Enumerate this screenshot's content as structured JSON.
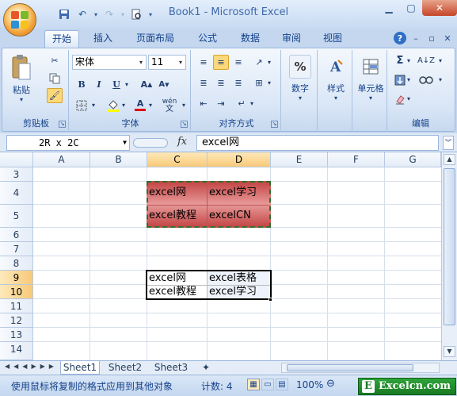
{
  "window": {
    "title": "Book1 - Microsoft Excel"
  },
  "ribbon_tabs": [
    "开始",
    "插入",
    "页面布局",
    "公式",
    "数据",
    "审阅",
    "视图"
  ],
  "clipboard": {
    "paste": "粘贴",
    "label": "剪贴板"
  },
  "font": {
    "name": "宋体",
    "size": "11",
    "label": "字体",
    "bold": "B",
    "italic": "I",
    "underline": "U"
  },
  "alignment": {
    "label": "对齐方式"
  },
  "number": {
    "label": "数字",
    "percent": "%"
  },
  "styles": {
    "label": "样式"
  },
  "cells": {
    "label": "单元格"
  },
  "editing": {
    "label": "编辑"
  },
  "formula_bar": {
    "name_box": "2R x 2C",
    "fx": "fx",
    "value": "excel网"
  },
  "columns": [
    "A",
    "B",
    "C",
    "D",
    "E",
    "F",
    "G"
  ],
  "rows": [
    "3",
    "4",
    "5",
    "6",
    "7",
    "8",
    "9",
    "10",
    "11",
    "12",
    "13",
    "14"
  ],
  "cells_data": {
    "c4": "excel网",
    "d4": "excel学习",
    "c5": "excel教程",
    "d5": "excelCN",
    "c9": "excel网",
    "d9": "excel表格",
    "c10": "excel教程",
    "d10": "excel学习"
  },
  "sheet_tabs": [
    "Sheet1",
    "Sheet2",
    "Sheet3"
  ],
  "status": {
    "message": "使用鼠标将复制的格式应用到其他对象",
    "count": "计数: 4",
    "zoom": "100%"
  },
  "watermark": {
    "text": "Excelcn.com",
    "letter": "E"
  },
  "colors": {
    "selection_fill": "#d25b5b",
    "accent": "#15428b"
  }
}
